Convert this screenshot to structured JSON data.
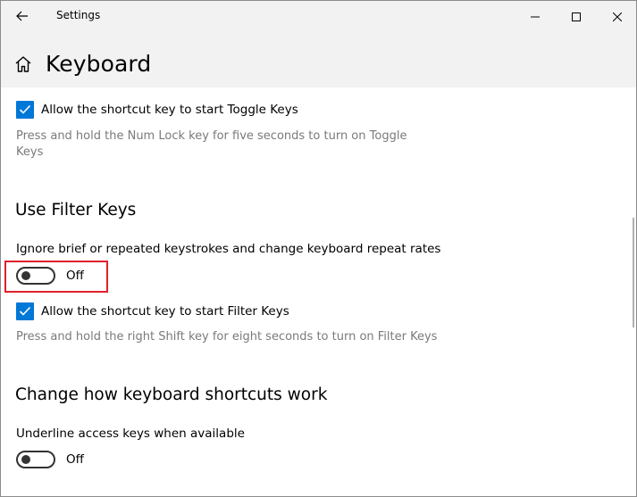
{
  "titlebar": {
    "app_title": "Settings",
    "icons": {
      "back": "back-arrow-icon",
      "minimize": "minimize-icon",
      "maximize": "maximize-icon",
      "close": "close-icon"
    }
  },
  "header": {
    "title": "Keyboard",
    "icon": "home-icon"
  },
  "toggle_keys": {
    "shortcut_checkbox_label": "Allow the shortcut key to start Toggle Keys",
    "shortcut_checked": true,
    "shortcut_description_line1": "Press and hold the Num Lock key for five seconds to turn on Toggle",
    "shortcut_description_line2": "Keys"
  },
  "filter_keys": {
    "heading": "Use Filter Keys",
    "setting_label": "Ignore brief or repeated keystrokes and change keyboard repeat rates",
    "toggle_state": "Off",
    "shortcut_checkbox_label": "Allow the shortcut key to start Filter Keys",
    "shortcut_checked": true,
    "shortcut_description": "Press and hold the right Shift key for eight seconds to turn on Filter Keys"
  },
  "shortcuts": {
    "heading": "Change how keyboard shortcuts work",
    "setting_label": "Underline access keys when available",
    "toggle_state": "Off"
  },
  "colors": {
    "accent": "#0078d7",
    "highlight": "#e0202a",
    "header_bg": "#f2f2f2",
    "description_text": "#7a7a7a"
  }
}
